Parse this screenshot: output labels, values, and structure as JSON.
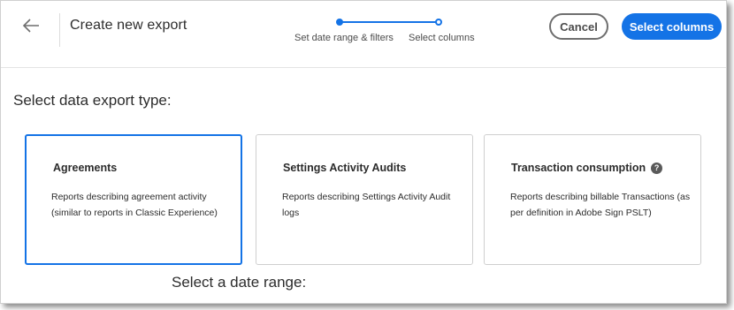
{
  "header": {
    "title": "Create new export",
    "steps": [
      {
        "label": "Set date range & filters",
        "state": "complete"
      },
      {
        "label": "Select columns",
        "state": "current"
      }
    ],
    "cancel_label": "Cancel",
    "primary_label": "Select columns",
    "back_icon": "arrow-left-icon"
  },
  "main": {
    "section_title": "Select data export type:",
    "cards": [
      {
        "title": "Agreements",
        "description": "Reports describing agreement activity (similar to reports in Classic Experience)",
        "selected": true
      },
      {
        "title": "Settings Activity Audits",
        "description": "Reports describing Settings Activity Audit logs",
        "selected": false
      },
      {
        "title": "Transaction consumption",
        "description": "Reports describing billable Transactions (as per definition in Adobe Sign PSLT)",
        "selected": false,
        "help_icon": "?"
      }
    ],
    "date_section_title": "Select a date range:"
  },
  "colors": {
    "accent": "#1473e6",
    "text": "#2c2c2c",
    "border": "#cfcfcf"
  }
}
